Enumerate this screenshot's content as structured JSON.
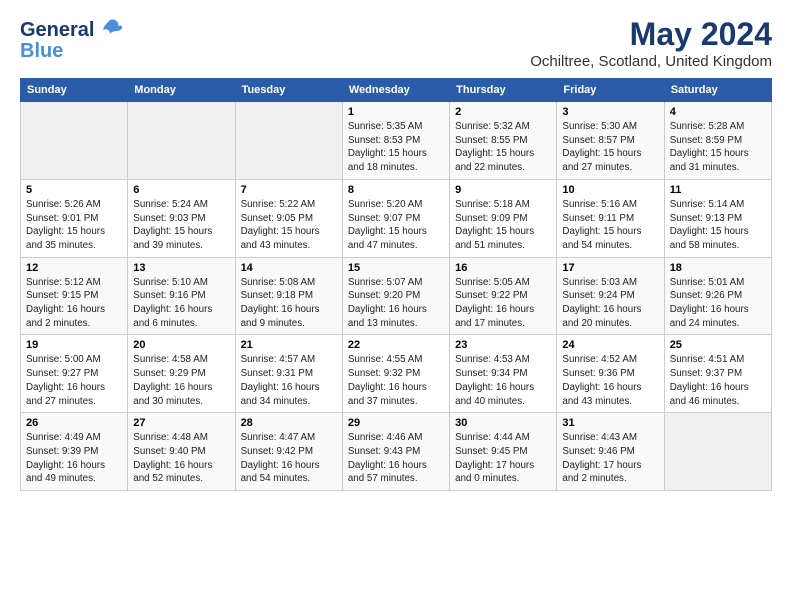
{
  "header": {
    "logo_line1": "General",
    "logo_line2": "Blue",
    "main_title": "May 2024",
    "subtitle": "Ochiltree, Scotland, United Kingdom"
  },
  "days_of_week": [
    "Sunday",
    "Monday",
    "Tuesday",
    "Wednesday",
    "Thursday",
    "Friday",
    "Saturday"
  ],
  "weeks": [
    [
      {
        "day": "",
        "info": ""
      },
      {
        "day": "",
        "info": ""
      },
      {
        "day": "",
        "info": ""
      },
      {
        "day": "1",
        "info": "Sunrise: 5:35 AM\nSunset: 8:53 PM\nDaylight: 15 hours\nand 18 minutes."
      },
      {
        "day": "2",
        "info": "Sunrise: 5:32 AM\nSunset: 8:55 PM\nDaylight: 15 hours\nand 22 minutes."
      },
      {
        "day": "3",
        "info": "Sunrise: 5:30 AM\nSunset: 8:57 PM\nDaylight: 15 hours\nand 27 minutes."
      },
      {
        "day": "4",
        "info": "Sunrise: 5:28 AM\nSunset: 8:59 PM\nDaylight: 15 hours\nand 31 minutes."
      }
    ],
    [
      {
        "day": "5",
        "info": "Sunrise: 5:26 AM\nSunset: 9:01 PM\nDaylight: 15 hours\nand 35 minutes."
      },
      {
        "day": "6",
        "info": "Sunrise: 5:24 AM\nSunset: 9:03 PM\nDaylight: 15 hours\nand 39 minutes."
      },
      {
        "day": "7",
        "info": "Sunrise: 5:22 AM\nSunset: 9:05 PM\nDaylight: 15 hours\nand 43 minutes."
      },
      {
        "day": "8",
        "info": "Sunrise: 5:20 AM\nSunset: 9:07 PM\nDaylight: 15 hours\nand 47 minutes."
      },
      {
        "day": "9",
        "info": "Sunrise: 5:18 AM\nSunset: 9:09 PM\nDaylight: 15 hours\nand 51 minutes."
      },
      {
        "day": "10",
        "info": "Sunrise: 5:16 AM\nSunset: 9:11 PM\nDaylight: 15 hours\nand 54 minutes."
      },
      {
        "day": "11",
        "info": "Sunrise: 5:14 AM\nSunset: 9:13 PM\nDaylight: 15 hours\nand 58 minutes."
      }
    ],
    [
      {
        "day": "12",
        "info": "Sunrise: 5:12 AM\nSunset: 9:15 PM\nDaylight: 16 hours\nand 2 minutes."
      },
      {
        "day": "13",
        "info": "Sunrise: 5:10 AM\nSunset: 9:16 PM\nDaylight: 16 hours\nand 6 minutes."
      },
      {
        "day": "14",
        "info": "Sunrise: 5:08 AM\nSunset: 9:18 PM\nDaylight: 16 hours\nand 9 minutes."
      },
      {
        "day": "15",
        "info": "Sunrise: 5:07 AM\nSunset: 9:20 PM\nDaylight: 16 hours\nand 13 minutes."
      },
      {
        "day": "16",
        "info": "Sunrise: 5:05 AM\nSunset: 9:22 PM\nDaylight: 16 hours\nand 17 minutes."
      },
      {
        "day": "17",
        "info": "Sunrise: 5:03 AM\nSunset: 9:24 PM\nDaylight: 16 hours\nand 20 minutes."
      },
      {
        "day": "18",
        "info": "Sunrise: 5:01 AM\nSunset: 9:26 PM\nDaylight: 16 hours\nand 24 minutes."
      }
    ],
    [
      {
        "day": "19",
        "info": "Sunrise: 5:00 AM\nSunset: 9:27 PM\nDaylight: 16 hours\nand 27 minutes."
      },
      {
        "day": "20",
        "info": "Sunrise: 4:58 AM\nSunset: 9:29 PM\nDaylight: 16 hours\nand 30 minutes."
      },
      {
        "day": "21",
        "info": "Sunrise: 4:57 AM\nSunset: 9:31 PM\nDaylight: 16 hours\nand 34 minutes."
      },
      {
        "day": "22",
        "info": "Sunrise: 4:55 AM\nSunset: 9:32 PM\nDaylight: 16 hours\nand 37 minutes."
      },
      {
        "day": "23",
        "info": "Sunrise: 4:53 AM\nSunset: 9:34 PM\nDaylight: 16 hours\nand 40 minutes."
      },
      {
        "day": "24",
        "info": "Sunrise: 4:52 AM\nSunset: 9:36 PM\nDaylight: 16 hours\nand 43 minutes."
      },
      {
        "day": "25",
        "info": "Sunrise: 4:51 AM\nSunset: 9:37 PM\nDaylight: 16 hours\nand 46 minutes."
      }
    ],
    [
      {
        "day": "26",
        "info": "Sunrise: 4:49 AM\nSunset: 9:39 PM\nDaylight: 16 hours\nand 49 minutes."
      },
      {
        "day": "27",
        "info": "Sunrise: 4:48 AM\nSunset: 9:40 PM\nDaylight: 16 hours\nand 52 minutes."
      },
      {
        "day": "28",
        "info": "Sunrise: 4:47 AM\nSunset: 9:42 PM\nDaylight: 16 hours\nand 54 minutes."
      },
      {
        "day": "29",
        "info": "Sunrise: 4:46 AM\nSunset: 9:43 PM\nDaylight: 16 hours\nand 57 minutes."
      },
      {
        "day": "30",
        "info": "Sunrise: 4:44 AM\nSunset: 9:45 PM\nDaylight: 17 hours\nand 0 minutes."
      },
      {
        "day": "31",
        "info": "Sunrise: 4:43 AM\nSunset: 9:46 PM\nDaylight: 17 hours\nand 2 minutes."
      },
      {
        "day": "",
        "info": ""
      }
    ]
  ]
}
